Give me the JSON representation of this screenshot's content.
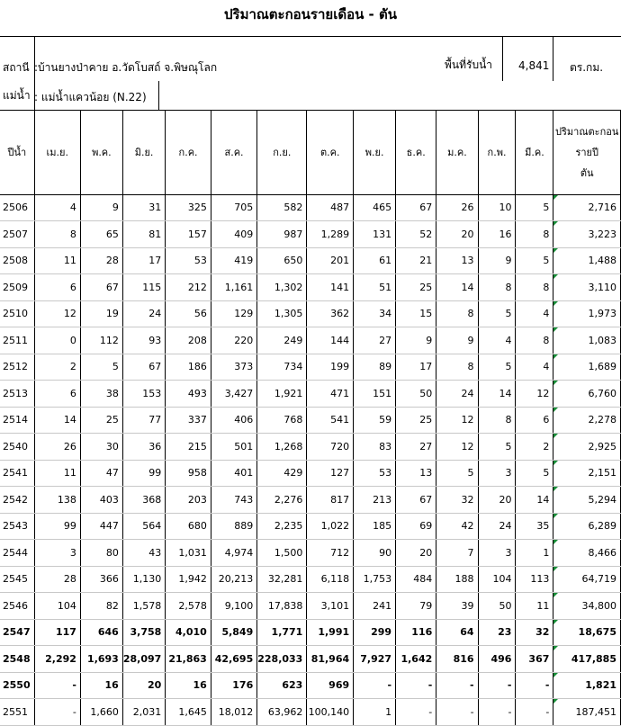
{
  "title": "ปริมาณตะกอนรายเดือน - ตัน",
  "station": {
    "label": "สถานี",
    "name": ":บ้านยางป่าคาย อ.วัดโบสถ์ จ.พิษณุโลก",
    "area_label": "พื้นที่รับน้ำ",
    "area_value": "4,841",
    "area_unit": "ตร.กม."
  },
  "river": {
    "label": "แม่น้ำ",
    "name": ": แม่น้ำแควน้อย (N.22)"
  },
  "columns": {
    "year": "ปีน้ำ",
    "months": [
      "เม.ย.",
      "พ.ค.",
      "มิ.ย.",
      "ก.ค.",
      "ส.ค.",
      "ก.ย.",
      "ต.ค.",
      "พ.ย.",
      "ธ.ค.",
      "ม.ค.",
      "ก.พ.",
      "มี.ค."
    ],
    "annual": [
      "ปริมาณตะกอน",
      "รายปี",
      "ตัน"
    ]
  },
  "rows": [
    {
      "year": "2506",
      "bold": false,
      "values": [
        "4",
        "9",
        "31",
        "325",
        "705",
        "582",
        "487",
        "465",
        "67",
        "26",
        "10",
        "5",
        "2,716"
      ]
    },
    {
      "year": "2507",
      "bold": false,
      "values": [
        "8",
        "65",
        "81",
        "157",
        "409",
        "987",
        "1,289",
        "131",
        "52",
        "20",
        "16",
        "8",
        "3,223"
      ]
    },
    {
      "year": "2508",
      "bold": false,
      "values": [
        "11",
        "28",
        "17",
        "53",
        "419",
        "650",
        "201",
        "61",
        "21",
        "13",
        "9",
        "5",
        "1,488"
      ]
    },
    {
      "year": "2509",
      "bold": false,
      "values": [
        "6",
        "67",
        "115",
        "212",
        "1,161",
        "1,302",
        "141",
        "51",
        "25",
        "14",
        "8",
        "8",
        "3,110"
      ]
    },
    {
      "year": "2510",
      "bold": false,
      "values": [
        "12",
        "19",
        "24",
        "56",
        "129",
        "1,305",
        "362",
        "34",
        "15",
        "8",
        "5",
        "4",
        "1,973"
      ]
    },
    {
      "year": "2511",
      "bold": false,
      "values": [
        "0",
        "112",
        "93",
        "208",
        "220",
        "249",
        "144",
        "27",
        "9",
        "9",
        "4",
        "8",
        "1,083"
      ]
    },
    {
      "year": "2512",
      "bold": false,
      "values": [
        "2",
        "5",
        "67",
        "186",
        "373",
        "734",
        "199",
        "89",
        "17",
        "8",
        "5",
        "4",
        "1,689"
      ]
    },
    {
      "year": "2513",
      "bold": false,
      "values": [
        "6",
        "38",
        "153",
        "493",
        "3,427",
        "1,921",
        "471",
        "151",
        "50",
        "24",
        "14",
        "12",
        "6,760"
      ]
    },
    {
      "year": "2514",
      "bold": false,
      "values": [
        "14",
        "25",
        "77",
        "337",
        "406",
        "768",
        "541",
        "59",
        "25",
        "12",
        "8",
        "6",
        "2,278"
      ]
    },
    {
      "year": "2540",
      "bold": false,
      "values": [
        "26",
        "30",
        "36",
        "215",
        "501",
        "1,268",
        "720",
        "83",
        "27",
        "12",
        "5",
        "2",
        "2,925"
      ]
    },
    {
      "year": "2541",
      "bold": false,
      "values": [
        "11",
        "47",
        "99",
        "958",
        "401",
        "429",
        "127",
        "53",
        "13",
        "5",
        "3",
        "5",
        "2,151"
      ]
    },
    {
      "year": "2542",
      "bold": false,
      "values": [
        "138",
        "403",
        "368",
        "203",
        "743",
        "2,276",
        "817",
        "213",
        "67",
        "32",
        "20",
        "14",
        "5,294"
      ]
    },
    {
      "year": "2543",
      "bold": false,
      "values": [
        "99",
        "447",
        "564",
        "680",
        "889",
        "2,235",
        "1,022",
        "185",
        "69",
        "42",
        "24",
        "35",
        "6,289"
      ]
    },
    {
      "year": "2544",
      "bold": false,
      "values": [
        "3",
        "80",
        "43",
        "1,031",
        "4,974",
        "1,500",
        "712",
        "90",
        "20",
        "7",
        "3",
        "1",
        "8,466"
      ]
    },
    {
      "year": "2545",
      "bold": false,
      "values": [
        "28",
        "366",
        "1,130",
        "1,942",
        "20,213",
        "32,281",
        "6,118",
        "1,753",
        "484",
        "188",
        "104",
        "113",
        "64,719"
      ]
    },
    {
      "year": "2546",
      "bold": false,
      "values": [
        "104",
        "82",
        "1,578",
        "2,578",
        "9,100",
        "17,838",
        "3,101",
        "241",
        "79",
        "39",
        "50",
        "11",
        "34,800"
      ]
    },
    {
      "year": "2547",
      "bold": true,
      "values": [
        "117",
        "646",
        "3,758",
        "4,010",
        "5,849",
        "1,771",
        "1,991",
        "299",
        "116",
        "64",
        "23",
        "32",
        "18,675"
      ]
    },
    {
      "year": "2548",
      "bold": true,
      "values": [
        "2,292",
        "1,693",
        "28,097",
        "21,863",
        "42,695",
        "228,033",
        "81,964",
        "7,927",
        "1,642",
        "816",
        "496",
        "367",
        "417,885"
      ]
    },
    {
      "year": "2550",
      "bold": true,
      "values": [
        "-",
        "16",
        "20",
        "16",
        "176",
        "623",
        "969",
        "-",
        "-",
        "-",
        "-",
        "-",
        "1,821"
      ]
    },
    {
      "year": "2551",
      "bold": false,
      "values": [
        "-",
        "1,660",
        "2,031",
        "1,645",
        "18,012",
        "63,962",
        "100,140",
        "1",
        "-",
        "-",
        "-",
        "-",
        "187,451"
      ]
    }
  ]
}
